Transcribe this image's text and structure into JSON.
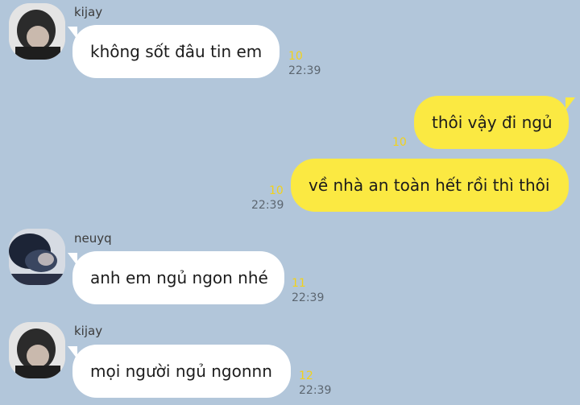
{
  "messages": [
    {
      "side": "in",
      "sender": "kijay",
      "avatar": "avatar-icon",
      "text": "không sốt đâu tin em",
      "unread": "10",
      "time": "22:39"
    },
    {
      "side": "out",
      "text": "thôi vậy đi ngủ",
      "unread": "10",
      "time": ""
    },
    {
      "side": "out",
      "text": "về nhà an toàn hết rồi thì thôi",
      "unread": "10",
      "time": "22:39"
    },
    {
      "side": "in",
      "sender": "neuyq",
      "avatar": "avatar-icon",
      "text": "anh em ngủ ngon nhé",
      "unread": "11",
      "time": "22:39"
    },
    {
      "side": "in",
      "sender": "kijay",
      "avatar": "avatar-icon",
      "text": "mọi người ngủ ngonnn",
      "unread": "12",
      "time": "22:39"
    }
  ],
  "colors": {
    "background": "#b2c6da",
    "incoming_bubble": "#ffffff",
    "outgoing_bubble": "#fbe942",
    "unread_count": "#f2d21b"
  }
}
